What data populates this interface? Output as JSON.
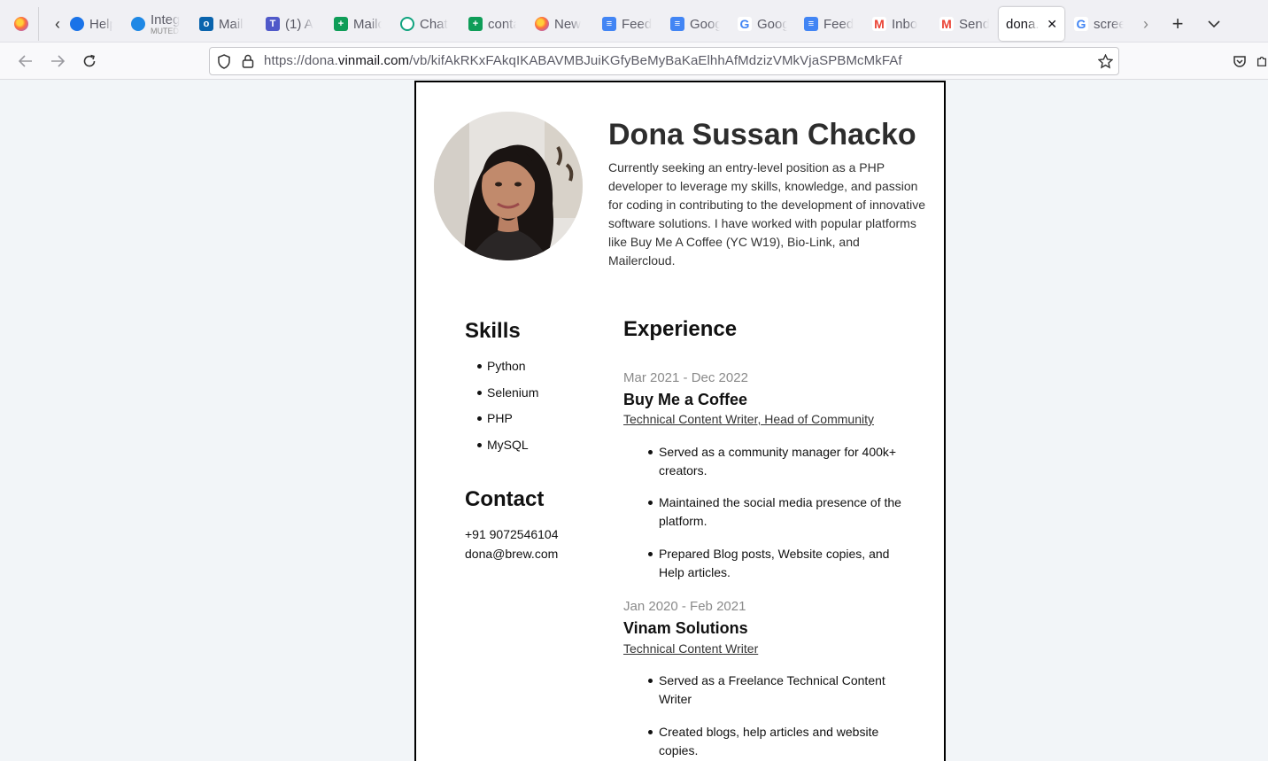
{
  "browser": {
    "tabs": [
      {
        "label": "Help",
        "icon": "help-icon",
        "color": "#1a73e8"
      },
      {
        "label": "Integ",
        "sub": "MUTED",
        "icon": "cloud-icon",
        "color": "#1e88e5"
      },
      {
        "label": "Mail",
        "icon": "outlook-icon",
        "color": "#0a64ad"
      },
      {
        "label": "(1) A",
        "icon": "teams-icon",
        "color": "#5059c9"
      },
      {
        "label": "Mailc",
        "icon": "sheets-icon",
        "color": "#0f9d58"
      },
      {
        "label": "Chat",
        "icon": "chatgpt-icon",
        "color": "#10a37f"
      },
      {
        "label": "conta",
        "icon": "sheets-icon",
        "color": "#0f9d58"
      },
      {
        "label": "New",
        "icon": "firefox-icon",
        "color": "#ff7139"
      },
      {
        "label": "Feed",
        "icon": "docs-icon",
        "color": "#4285f4"
      },
      {
        "label": "Goog",
        "icon": "docs-icon",
        "color": "#4285f4"
      },
      {
        "label": "Goog",
        "icon": "google-icon",
        "color": "#4285f4"
      },
      {
        "label": "Feed",
        "icon": "docs-icon",
        "color": "#4285f4"
      },
      {
        "label": "Inbo",
        "icon": "gmail-icon",
        "color": "#ea4335"
      },
      {
        "label": "Send",
        "icon": "gmail-icon",
        "color": "#ea4335"
      },
      {
        "label": "dona.v",
        "icon": "",
        "color": "#ffffff",
        "active": true
      },
      {
        "label": "scree",
        "icon": "google-icon",
        "color": "#4285f4"
      }
    ],
    "url": {
      "prefix": "https://dona.",
      "domain": "vinmail.com",
      "path": "/vb/kifAkRKxFAkqIKABAVMBJuiKGfyBeMyBaKaElhhAfMdzizVMkVjaSPBMcMkFAf"
    }
  },
  "resume": {
    "name": "Dona Sussan Chacko",
    "summary": "Currently seeking an entry-level position as a PHP developer to leverage my skills, knowledge, and passion for coding in contributing to the development of innovative software solutions. I have worked with popular platforms like Buy Me A Coffee (YC W19), Bio-Link, and Mailercloud.",
    "skills_heading": "Skills",
    "skills": [
      "Python",
      "Selenium",
      "PHP",
      "MySQL"
    ],
    "contact_heading": "Contact",
    "contact": {
      "phone": "+91 9072546104",
      "email": "dona@brew.com"
    },
    "experience_heading": "Experience",
    "jobs": [
      {
        "dates": "Mar 2021 - Dec 2022",
        "company": "Buy Me a Coffee",
        "role": "Technical Content Writer, Head of Community",
        "bullets": [
          "Served as a community manager for 400k+ creators.",
          "Maintained the social media presence of the platform.",
          "Prepared Blog posts, Website copies, and Help articles."
        ]
      },
      {
        "dates": "Jan 2020 - Feb 2021",
        "company": "Vinam Solutions",
        "role": "Technical Content Writer",
        "bullets": [
          "Served as a Freelance Technical Content Writer",
          "Created blogs, help articles and website copies."
        ]
      }
    ]
  }
}
